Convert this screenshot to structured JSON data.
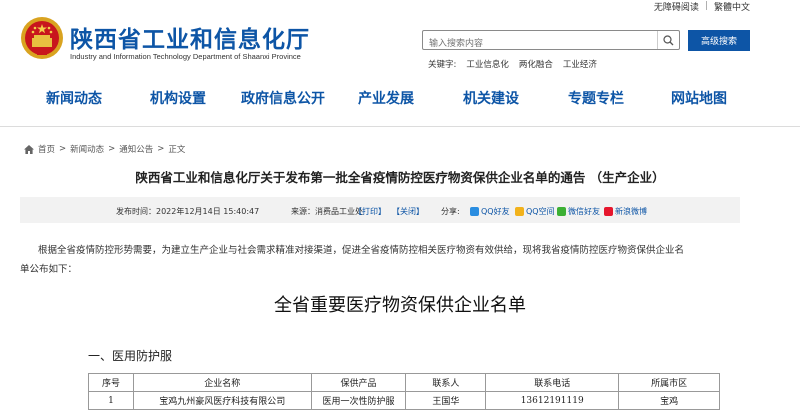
{
  "topbar": {
    "accessible": "无障碍阅读",
    "separator": "|",
    "traditional": "繁體中文"
  },
  "header": {
    "title": "陕西省工业和信息化厅",
    "subtitle": "Industry and Information Technology Department of Shaanxi Province",
    "emblem_icon": "national-emblem-icon",
    "search_placeholder": "输入搜索内容",
    "advanced_search": "高级搜索",
    "keywords_label": "关键字:",
    "keywords": [
      "工业信息化",
      "两化融合",
      "工业经济"
    ]
  },
  "nav": {
    "items": [
      "新闻动态",
      "机构设置",
      "政府信息公开",
      "产业发展",
      "机关建设",
      "专题专栏",
      "网站地图"
    ]
  },
  "breadcrumb": {
    "home_icon": "home-icon",
    "items": [
      "首页",
      "新闻动态",
      "通知公告",
      "正文"
    ],
    "separator": ">"
  },
  "article": {
    "title": "陕西省工业和信息化厅关于发布第一批全省疫情防控医疗物资保供企业名单的通告 （生产企业）",
    "publish_time": "发布时间：2022年12月14日 15:40:47",
    "source": "来源：消费品工业处",
    "print": "【打印】",
    "close": "【关闭】",
    "share_label": "分享:",
    "share": [
      {
        "label": "QQ好友",
        "icon": "qq-icon",
        "color": "#2a8de0"
      },
      {
        "label": "QQ空间",
        "icon": "qzone-icon",
        "color": "#f2b21b"
      },
      {
        "label": "微信好友",
        "icon": "wechat-icon",
        "color": "#3cb034"
      },
      {
        "label": "新浪微博",
        "icon": "weibo-icon",
        "color": "#e6162d"
      }
    ],
    "paragraph_line1": "根据全省疫情防控形势需要，为建立生产企业与社会需求精准对接渠道，促进全省疫情防控相关医疗物资有效供给，现将我省疫情防控医疗物资保供企业名",
    "paragraph_line2": "单公布如下："
  },
  "list": {
    "title": "全省重要医疗物资保供企业名单",
    "section": "一、医用防护服",
    "headers": [
      "序号",
      "企业名称",
      "保供产品",
      "联系人",
      "联系电话",
      "所属市区"
    ],
    "rows": [
      [
        "1",
        "宝鸡九州豪风医疗科技有限公司",
        "医用一次性防护服",
        "王国华",
        "13612191119",
        "宝鸡"
      ]
    ]
  },
  "colors": {
    "brand": "#0d55a6",
    "meta_bg": "#f2f2f2"
  }
}
